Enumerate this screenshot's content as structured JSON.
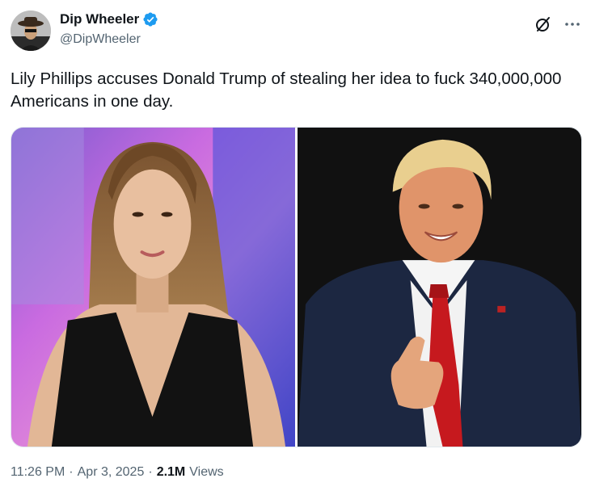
{
  "user": {
    "display_name": "Dip Wheeler",
    "handle": "@DipWheeler",
    "verified": true,
    "verified_color": "#1d9bf0"
  },
  "actions": {
    "grok_icon": "grok-icon",
    "more_icon": "more-icon"
  },
  "tweet": {
    "text": "Lily Phillips accuses Donald Trump of stealing her idea to fuck 340,000,000 Americans in one day."
  },
  "media": [
    {
      "name": "photo-woman"
    },
    {
      "name": "photo-man-thumbs-up"
    }
  ],
  "meta": {
    "time": "11:26 PM",
    "dot1": "·",
    "date": "Apr 3, 2025",
    "dot2": "·",
    "views_count": "2.1M",
    "views_label": "Views"
  }
}
